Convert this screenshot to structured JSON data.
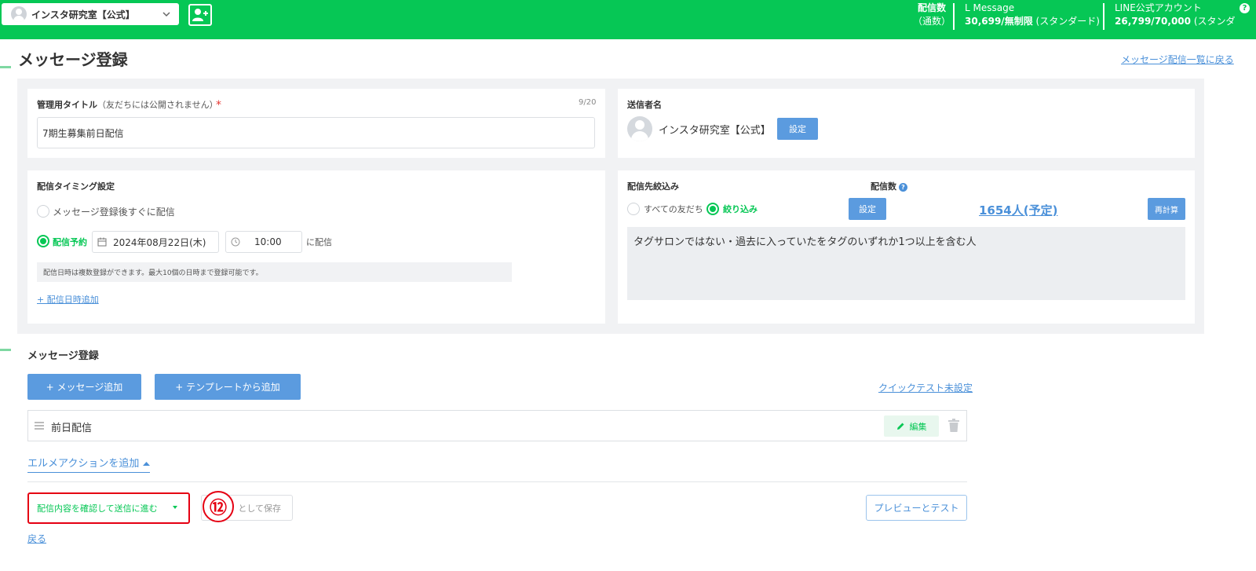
{
  "header": {
    "account_name": "インスタ研究室【公式】",
    "stats_label_1": "配信数",
    "stats_label_2": "（通数）",
    "lmessage_label": "L Message",
    "lmessage_value": "30,699/無制限",
    "lmessage_plan": "(スタンダード)",
    "line_label": "LINE公式アカウント",
    "line_value": "26,799/70,000",
    "line_plan": "(スタンダ",
    "help_glyph": "?"
  },
  "page": {
    "title": "メッセージ登録",
    "back_to_list": "メッセージ配信一覧に戻る"
  },
  "admin_title": {
    "label": "管理用タイトル",
    "label_note": "（友だちには公開されません）",
    "required_mark": "*",
    "counter": "9/20",
    "value": "7期生募集前日配信"
  },
  "sender": {
    "label": "送信者名",
    "name": "インスタ研究室【公式】",
    "set_button": "設定"
  },
  "timing": {
    "label": "配信タイミング設定",
    "option_immediate": "メッセージ登録後すぐに配信",
    "option_scheduled": "配信予約",
    "date": "2024年08月22日(木)",
    "time": "10:00",
    "suffix": "に配信",
    "note": "配信日時は複数登録ができます。最大10個の日時まで登録可能です。",
    "add_datetime": "+ 配信日時追加"
  },
  "targeting": {
    "label": "配信先絞込み",
    "count_label": "配信数",
    "option_all": "すべての友だち",
    "option_filter": "絞り込み",
    "set_button": "設定",
    "count_value": "1654人(予定)",
    "recalc_button": "再計算",
    "condition": "タグサロンではない・過去に入っていたをタグのいずれか1つ以上を含む人"
  },
  "messages": {
    "section_title": "メッセージ登録",
    "add_message": "+ メッセージ追加",
    "add_template": "+ テンプレートから追加",
    "quick_test": "クイックテスト未設定",
    "items": [
      {
        "name": "前日配信",
        "edit_label": "編集"
      }
    ],
    "add_action": "エルメアクションを追加"
  },
  "footer": {
    "confirm_button": "配信内容を確認して送信に進む",
    "step_number": "⑫",
    "save_as": "として保存",
    "preview_test": "プレビューとテスト",
    "back": "戻る"
  },
  "colors": {
    "brand_green": "#06c755",
    "accent_blue": "#5b9bdf",
    "highlight_red": "#e50012"
  }
}
